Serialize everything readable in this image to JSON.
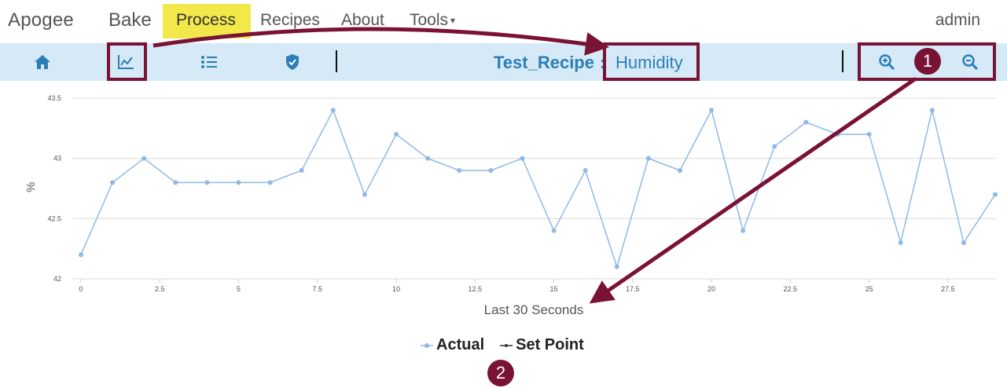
{
  "nav": {
    "brand": "Apogee",
    "brand2": "Bake",
    "items": [
      {
        "label": "Process"
      },
      {
        "label": "Recipes"
      },
      {
        "label": "About"
      },
      {
        "label": "Tools"
      }
    ],
    "user": "admin"
  },
  "toolbar": {
    "icons": [
      "home-icon",
      "chart-icon",
      "list-icon",
      "shield-check-icon"
    ],
    "recipe_name": "Test_Recipe",
    "colon": ":",
    "parameter": "Humidity",
    "zoom_in_icon": "zoom-in-icon",
    "zoom_out_icon": "zoom-out-icon"
  },
  "annotations": {
    "badge1": "1",
    "badge2": "2",
    "color": "#7a1235"
  },
  "colors": {
    "highlight": "#f3e84a",
    "toolbar_bg": "#d6e9f6",
    "accent": "#2a7fb8",
    "series_actual": "#8fb9e6"
  },
  "chart_data": {
    "type": "line",
    "xlabel": "Last 30 Seconds",
    "ylabel": "%",
    "xlim": [
      0,
      29
    ],
    "ylim": [
      42,
      43.5
    ],
    "xticks": [
      "0",
      "2.5",
      "5",
      "7.5",
      "10",
      "12.5",
      "15",
      "17.5",
      "20",
      "22.5",
      "25",
      "27.5"
    ],
    "yticks": [
      "42",
      "42.5",
      "43",
      "43.5"
    ],
    "series": [
      {
        "name": "Actual",
        "x": [
          0,
          1,
          2,
          3,
          4,
          5,
          6,
          7,
          8,
          9,
          10,
          11,
          12,
          13,
          14,
          15,
          16,
          17,
          18,
          19,
          20,
          21,
          22,
          23,
          24,
          25,
          26,
          27,
          28,
          29
        ],
        "values": [
          42.2,
          42.8,
          43.0,
          42.8,
          42.8,
          42.8,
          42.8,
          42.9,
          43.4,
          42.7,
          43.2,
          43.0,
          42.9,
          42.9,
          43.0,
          42.4,
          42.9,
          42.1,
          43.0,
          42.9,
          43.4,
          42.4,
          43.1,
          43.3,
          43.2,
          43.2,
          42.3,
          43.4,
          42.3,
          42.7
        ]
      },
      {
        "name": "Set Point",
        "x": [],
        "values": []
      }
    ],
    "legend": "bottom-center"
  }
}
